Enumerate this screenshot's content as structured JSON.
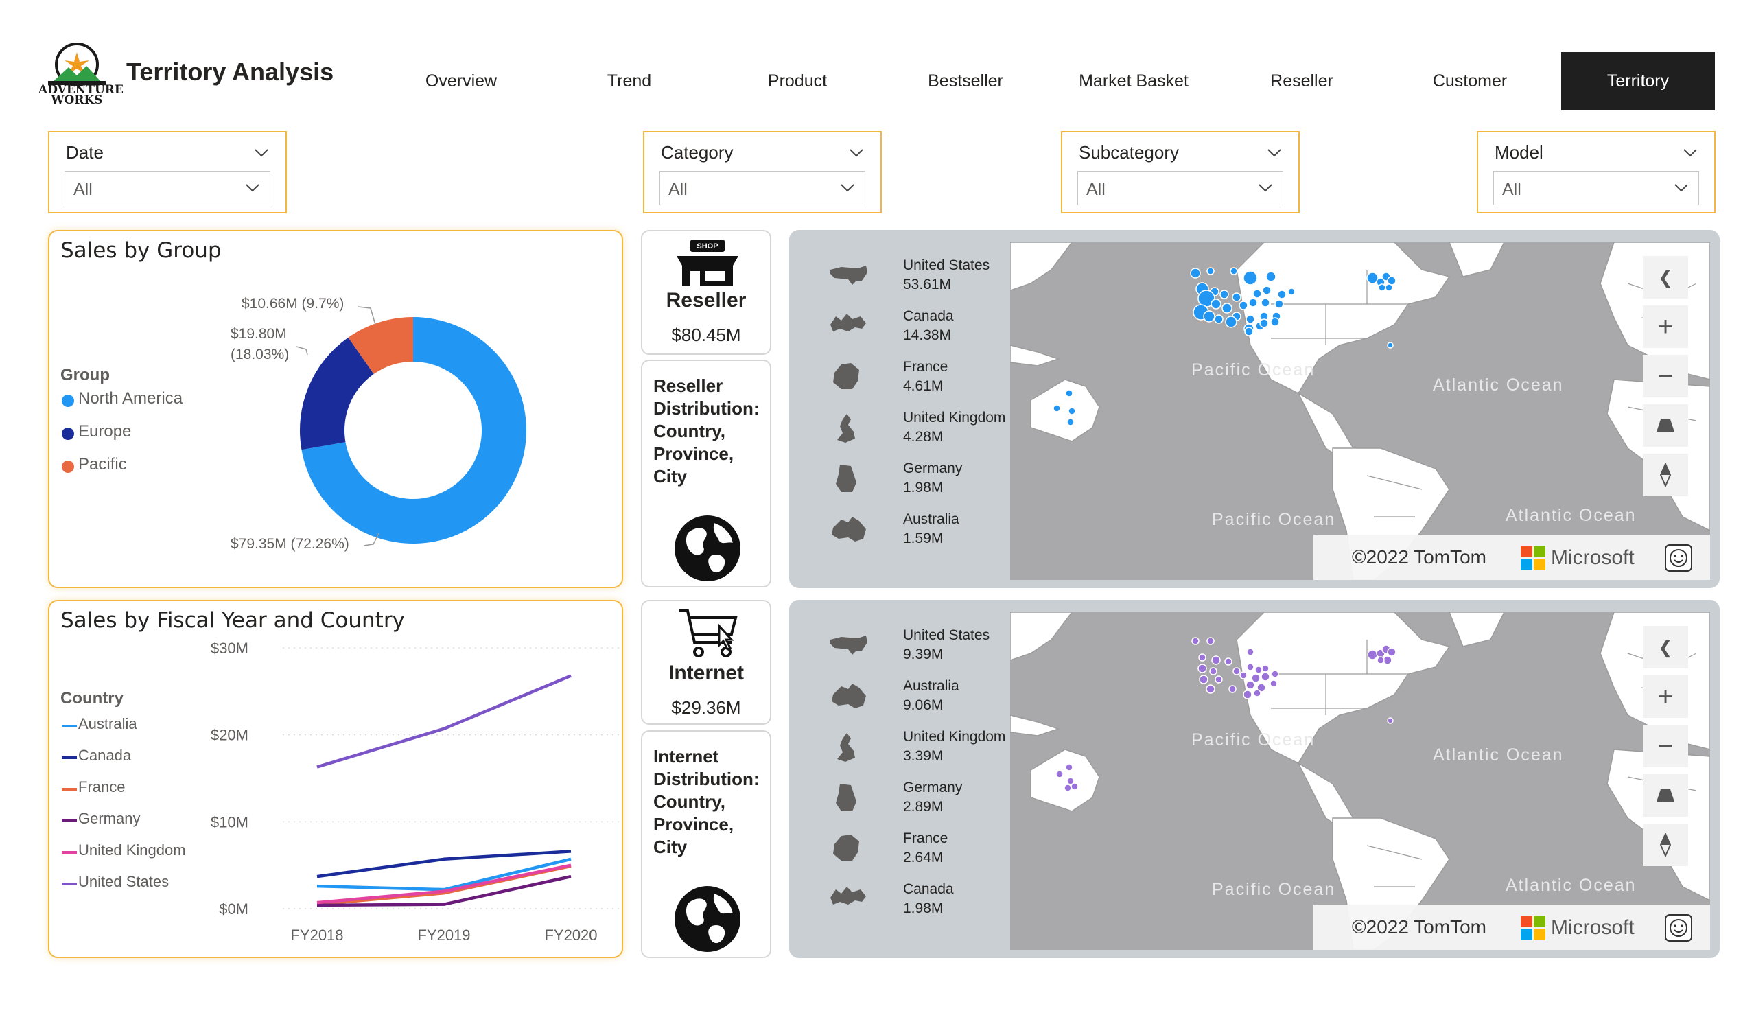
{
  "header": {
    "title": "Territory Analysis",
    "logo_text_line1": "ADVENTURE",
    "logo_text_line2": "WORKS",
    "nav": [
      {
        "label": "Overview",
        "active": false
      },
      {
        "label": "Trend",
        "active": false
      },
      {
        "label": "Product",
        "active": false
      },
      {
        "label": "Bestseller",
        "active": false
      },
      {
        "label": "Market Basket",
        "active": false
      },
      {
        "label": "Reseller",
        "active": false
      },
      {
        "label": "Customer",
        "active": false
      },
      {
        "label": "Territory",
        "active": true
      }
    ]
  },
  "slicers": [
    {
      "title": "Date",
      "value": "All"
    },
    {
      "title": "Category",
      "value": "All"
    },
    {
      "title": "Subcategory",
      "value": "All"
    },
    {
      "title": "Model",
      "value": "All"
    }
  ],
  "donut": {
    "title": "Sales by Group",
    "legend_title": "Group",
    "labels": {
      "pacific": "$10.66M (9.7%)",
      "europe_line1": "$19.80M",
      "europe_line2": "(18.03%)",
      "north_america": "$79.35M (72.26%)"
    }
  },
  "line": {
    "title": "Sales by Fiscal Year and Country",
    "legend_title": "Country"
  },
  "kpis": {
    "reseller": {
      "label": "Reseller",
      "value": "$80.45M",
      "icon_text": "SHOP",
      "dist_text": "Reseller Distribution: Country, Province, City"
    },
    "internet": {
      "label": "Internet",
      "value": "$29.36M",
      "dist_text": "Internet Distribution: Country, Province, City"
    }
  },
  "maps": {
    "reseller": {
      "dot_color": "#2196f3",
      "countries": [
        {
          "name": "United States",
          "value": "53.61M"
        },
        {
          "name": "Canada",
          "value": "14.38M"
        },
        {
          "name": "France",
          "value": "4.61M"
        },
        {
          "name": "United Kingdom",
          "value": "4.28M"
        },
        {
          "name": "Germany",
          "value": "1.98M"
        },
        {
          "name": "Australia",
          "value": "1.59M"
        }
      ]
    },
    "internet": {
      "dot_color": "#9b72d9",
      "countries": [
        {
          "name": "United States",
          "value": "9.39M"
        },
        {
          "name": "Australia",
          "value": "9.06M"
        },
        {
          "name": "United Kingdom",
          "value": "3.39M"
        },
        {
          "name": "Germany",
          "value": "2.89M"
        },
        {
          "name": "France",
          "value": "2.64M"
        },
        {
          "name": "Canada",
          "value": "1.98M"
        }
      ]
    },
    "ocean_labels": [
      "Pacific Ocean",
      "Atlantic Ocean",
      "Pacific Ocean",
      "Atlantic Ocean"
    ],
    "attribution": "©2022 TomTom",
    "provider": "Microsoft"
  },
  "colors": {
    "accent_border": "#f4b73e",
    "nav_active_bg": "#1f1f1f",
    "north_america": "#2196f3",
    "europe": "#1a2b9a",
    "pacific": "#e8693f"
  },
  "chart_data": [
    {
      "type": "pie",
      "title": "Sales by Group",
      "legend_title": "Group",
      "categories": [
        "North America",
        "Europe",
        "Pacific"
      ],
      "values": [
        79.35,
        19.8,
        10.66
      ],
      "percents": [
        72.26,
        18.03,
        9.7
      ],
      "colors": [
        "#2196f3",
        "#1a2b9a",
        "#e8693f"
      ],
      "legend_position": "left"
    },
    {
      "type": "line",
      "title": "Sales by Fiscal Year and Country",
      "legend_title": "Country",
      "categories": [
        "FY2018",
        "FY2019",
        "FY2020"
      ],
      "y_ticks": [
        "$0M",
        "$10M",
        "$20M",
        "$30M"
      ],
      "ylim": [
        0,
        30
      ],
      "grid": true,
      "legend_position": "left",
      "series": [
        {
          "name": "Australia",
          "color": "#2196f3",
          "values": [
            2.6,
            2.2,
            5.7
          ]
        },
        {
          "name": "Canada",
          "color": "#1a2b9a",
          "values": [
            3.7,
            5.7,
            6.6
          ]
        },
        {
          "name": "France",
          "color": "#e8693f",
          "values": [
            0.5,
            1.8,
            4.9
          ]
        },
        {
          "name": "Germany",
          "color": "#6a1b7a",
          "values": [
            0.4,
            0.5,
            3.7
          ]
        },
        {
          "name": "United Kingdom",
          "color": "#e2439f",
          "values": [
            0.7,
            2.0,
            5.0
          ]
        },
        {
          "name": "United States",
          "color": "#7b54c8",
          "values": [
            16.3,
            20.7,
            26.8
          ]
        }
      ]
    }
  ]
}
